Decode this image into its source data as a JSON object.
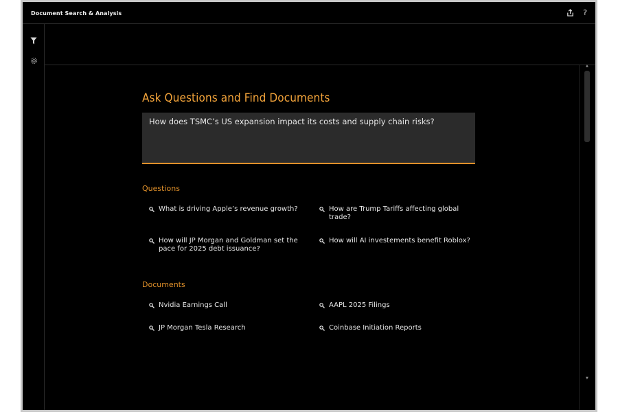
{
  "app": {
    "title": "Document Search & Analysis"
  },
  "titlebar_icons": [
    "share-icon",
    "help-icon"
  ],
  "help_glyph": "?",
  "rail_icons": [
    "filter-icon",
    "settings-icon"
  ],
  "main": {
    "heading": "Ask Questions and Find Documents",
    "query": "How does TSMC’s US expansion impact its costs and supply chain risks?",
    "questions_label": "Questions",
    "questions": [
      "What is driving Apple’s revenue growth?",
      "How are Trump Tariffs affecting global trade?",
      "How will JP Morgan and Goldman set the pace for 2025 debt issuance?",
      "How will AI investements benefit Roblox?"
    ],
    "documents_label": "Documents",
    "documents": [
      "Nvidia Earnings Call",
      "AAPL 2025 Filings",
      "JP Morgan Tesla Research",
      "Coinbase Initiation Reports"
    ]
  },
  "colors": {
    "accent": "#f2a33a",
    "background": "#000000",
    "input_bg": "#2b2b2b",
    "text": "#e6e6e6"
  }
}
